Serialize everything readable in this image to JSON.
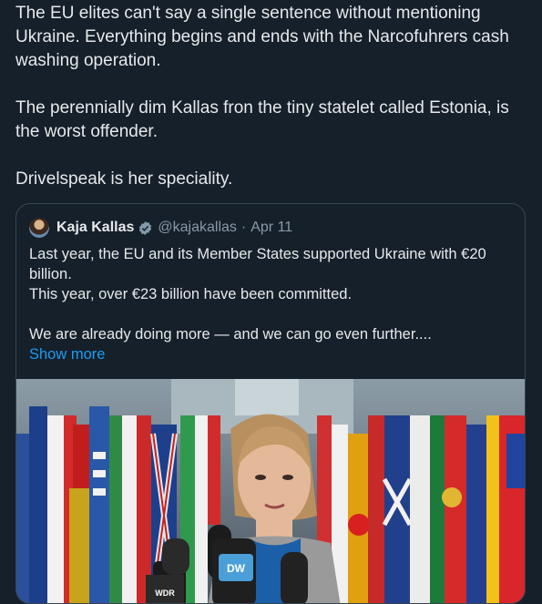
{
  "post": {
    "paragraphs": [
      "The EU elites can't say a single sentence without mentioning Ukraine. Everything begins and ends with the Narcofuhrers cash washing operation.",
      "The perennially dim Kallas fron the tiny statelet called Estonia, is the worst offender.",
      "Drivelspeak is her speciality."
    ]
  },
  "quote": {
    "author_name": "Kaja Kallas",
    "handle": "@kajakallas",
    "separator": "·",
    "date": "Apr 11",
    "lines": [
      "Last year, the EU and its Member States supported Ukraine with €20 billion.",
      "This year, over €23 billion have been committed.",
      "",
      "We are already doing more — and we can go even further...."
    ],
    "show_more": "Show more"
  },
  "media": {
    "mic_labels": [
      "WDR",
      "DW"
    ]
  },
  "colors": {
    "background": "#15202b",
    "text": "#e7e9ea",
    "muted": "#8b98a5",
    "link": "#1d9bf0",
    "border": "#38444d"
  }
}
